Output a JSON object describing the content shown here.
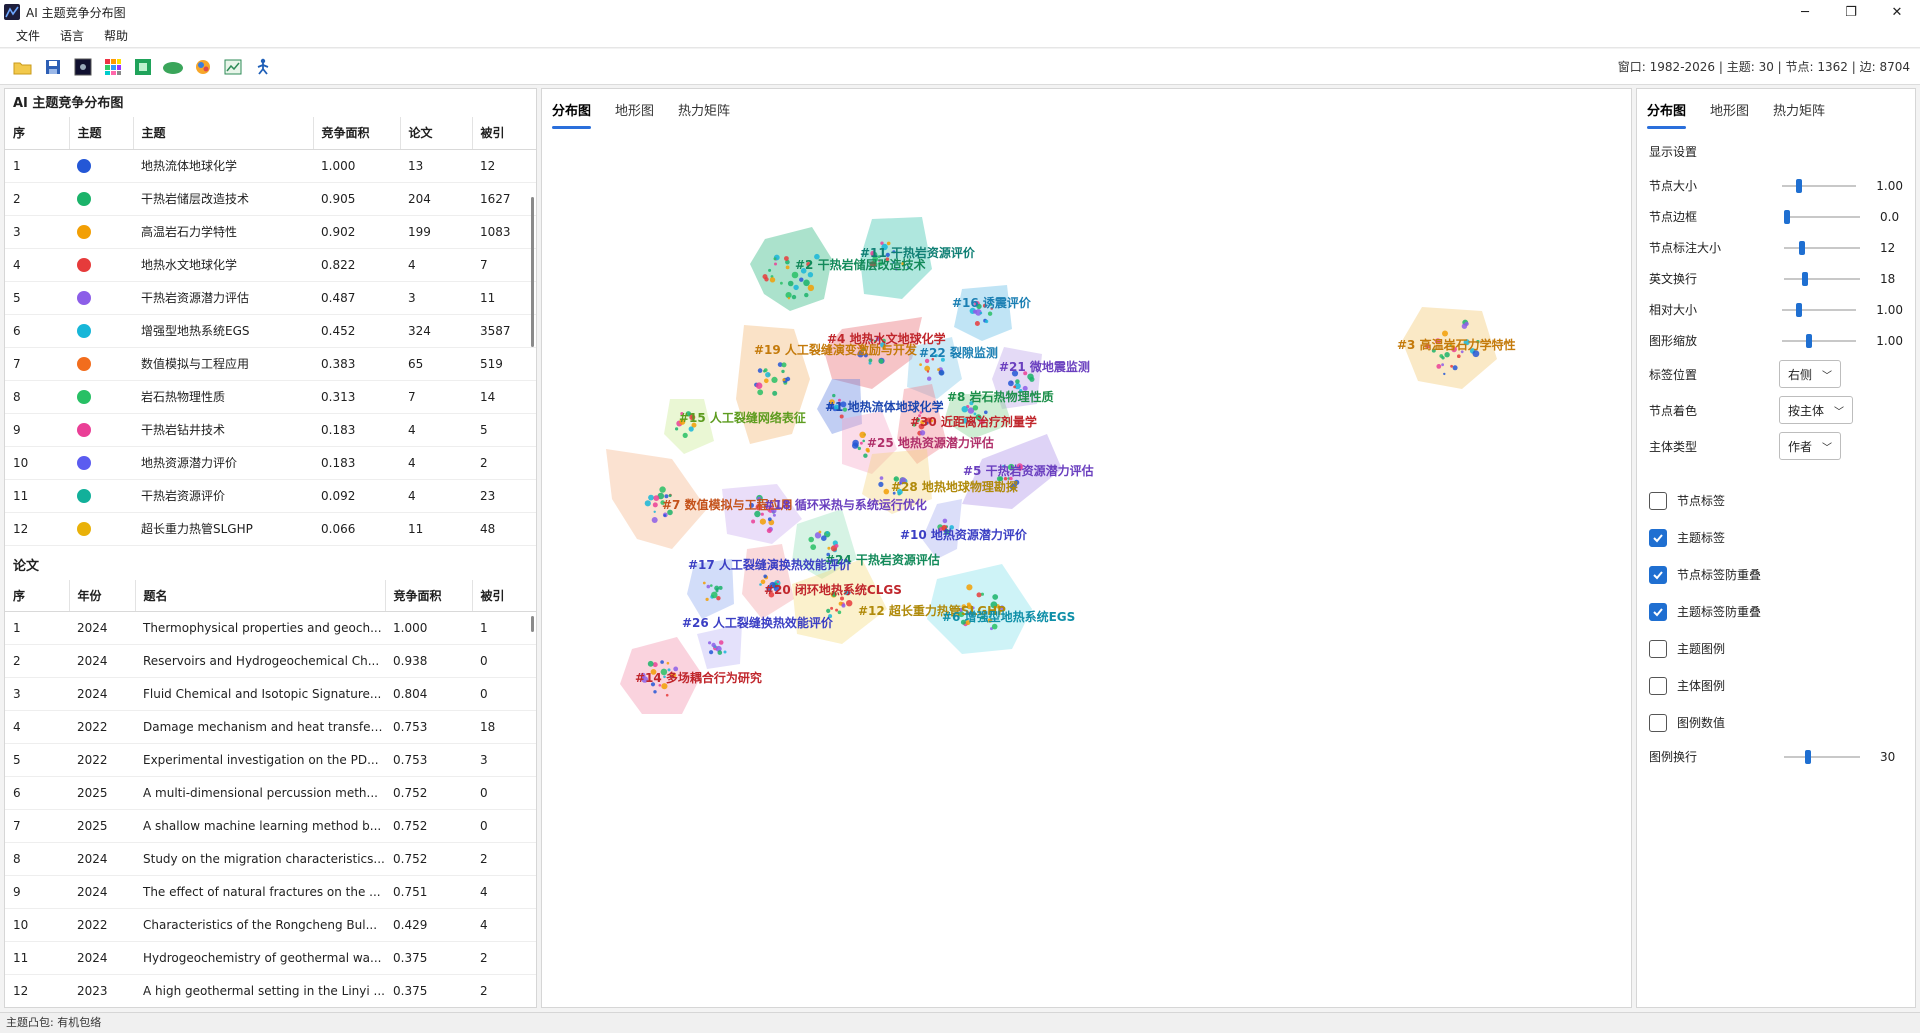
{
  "window": {
    "title": "AI 主题竞争分布图",
    "minimize": "─",
    "maximize": "❐",
    "close": "✕"
  },
  "menu": [
    "文件",
    "语言",
    "帮助"
  ],
  "toolbar": {
    "icons": [
      "open-folder-icon",
      "save-icon",
      "dark-square-icon",
      "palette-grid-icon",
      "green-frame-icon",
      "cloud-icon",
      "brain-color-icon",
      "chart-export-icon",
      "person-run-icon"
    ],
    "status": "窗口: 1982-2026 | 主题: 30 | 节点: 1362 | 边: 8704"
  },
  "topics": {
    "title": "AI 主题竞争分布图",
    "columns": [
      "序",
      "主题",
      "主题",
      "竞争面积",
      "论文",
      "被引"
    ],
    "rows": [
      {
        "idx": "1",
        "color": "#2457d6",
        "name": "地热流体地球化学",
        "score": "1.000",
        "papers": "13",
        "cites": "12"
      },
      {
        "idx": "2",
        "color": "#1bb36a",
        "name": "干热岩储层改造技术",
        "score": "0.905",
        "papers": "204",
        "cites": "1627"
      },
      {
        "idx": "3",
        "color": "#f29f05",
        "name": "高温岩石力学特性",
        "score": "0.902",
        "papers": "199",
        "cites": "1083"
      },
      {
        "idx": "4",
        "color": "#e63b3b",
        "name": "地热水文地球化学",
        "score": "0.822",
        "papers": "4",
        "cites": "7"
      },
      {
        "idx": "5",
        "color": "#8c5ee8",
        "name": "干热岩资源潜力评估",
        "score": "0.487",
        "papers": "3",
        "cites": "11"
      },
      {
        "idx": "6",
        "color": "#17b6d8",
        "name": "增强型地热系统EGS",
        "score": "0.452",
        "papers": "324",
        "cites": "3587"
      },
      {
        "idx": "7",
        "color": "#f26d1d",
        "name": "数值模拟与工程应用",
        "score": "0.383",
        "papers": "65",
        "cites": "519"
      },
      {
        "idx": "8",
        "color": "#28c065",
        "name": "岩石热物理性质",
        "score": "0.313",
        "papers": "7",
        "cites": "14"
      },
      {
        "idx": "9",
        "color": "#ea3f96",
        "name": "干热岩钻井技术",
        "score": "0.183",
        "papers": "4",
        "cites": "5"
      },
      {
        "idx": "10",
        "color": "#5b5cf0",
        "name": "地热资源潜力评价",
        "score": "0.183",
        "papers": "4",
        "cites": "2"
      },
      {
        "idx": "11",
        "color": "#12b09a",
        "name": "干热岩资源评价",
        "score": "0.092",
        "papers": "4",
        "cites": "23"
      },
      {
        "idx": "12",
        "color": "#e9b109",
        "name": "超长重力热管SLGHP",
        "score": "0.066",
        "papers": "11",
        "cites": "48"
      }
    ]
  },
  "papers": {
    "title": "论文",
    "columns": [
      "序",
      "年份",
      "题名",
      "竞争面积",
      "被引"
    ],
    "rows": [
      {
        "idx": "1",
        "year": "2024",
        "title": "Thermophysical properties and geoch...",
        "score": "1.000",
        "cites": "1"
      },
      {
        "idx": "2",
        "year": "2024",
        "title": "Reservoirs and Hydrogeochemical Ch...",
        "score": "0.938",
        "cites": "0"
      },
      {
        "idx": "3",
        "year": "2024",
        "title": "Fluid Chemical and Isotopic Signature...",
        "score": "0.804",
        "cites": "0"
      },
      {
        "idx": "4",
        "year": "2022",
        "title": "Damage mechanism and heat transfer...",
        "score": "0.753",
        "cites": "18"
      },
      {
        "idx": "5",
        "year": "2022",
        "title": "Experimental investigation on the PD...",
        "score": "0.753",
        "cites": "3"
      },
      {
        "idx": "6",
        "year": "2025",
        "title": "A multi-dimensional percussion meth...",
        "score": "0.752",
        "cites": "0"
      },
      {
        "idx": "7",
        "year": "2025",
        "title": "A shallow machine learning method b...",
        "score": "0.752",
        "cites": "0"
      },
      {
        "idx": "8",
        "year": "2024",
        "title": "Study on the migration characteristics...",
        "score": "0.752",
        "cites": "2"
      },
      {
        "idx": "9",
        "year": "2024",
        "title": "The effect of natural fractures on the ...",
        "score": "0.751",
        "cites": "4"
      },
      {
        "idx": "10",
        "year": "2022",
        "title": "Characteristics of the Rongcheng Bul...",
        "score": "0.429",
        "cites": "4"
      },
      {
        "idx": "11",
        "year": "2024",
        "title": "Hydrogeochemistry of geothermal wa...",
        "score": "0.375",
        "cites": "2"
      },
      {
        "idx": "12",
        "year": "2023",
        "title": "A high geothermal setting in the Linyi ...",
        "score": "0.375",
        "cites": "2"
      }
    ]
  },
  "center_tabs": [
    "分布图",
    "地形图",
    "热力矩阵"
  ],
  "map_labels": [
    {
      "text": "#2 干热岩储层改造技术",
      "color": "#138a5a"
    },
    {
      "text": "#11 干热岩资源评价",
      "color": "#0f7f74"
    },
    {
      "text": "#16 诱震评价",
      "color": "#1b7fb3"
    },
    {
      "text": "#4 地热水文地球化学",
      "color": "#c0262c"
    },
    {
      "text": "#19 人工裂缝演变激励与开发",
      "color": "#c47a0a"
    },
    {
      "text": "#22 裂隙监测",
      "color": "#1b7fb3"
    },
    {
      "text": "#21 微地震监测",
      "color": "#6a3fbf"
    },
    {
      "text": "#3 高温岩石力学特性",
      "color": "#c47a0a"
    },
    {
      "text": "#8 岩石热物理性质",
      "color": "#1c8f4a"
    },
    {
      "text": "#1 地热流体地球化学",
      "color": "#1d47b0"
    },
    {
      "text": "#15 人工裂缝网络表征",
      "color": "#5d9c1f"
    },
    {
      "text": "#30 近距离治疗剂量学",
      "color": "#c0262c"
    },
    {
      "text": "#25 地热资源潜力评估",
      "color": "#b0306a"
    },
    {
      "text": "#5 干热岩资源潜力评估",
      "color": "#6a3fbf"
    },
    {
      "text": "#28 地热地球物理勘探",
      "color": "#b08a0a"
    },
    {
      "text": "#7 数值模拟与工程应用",
      "color": "#c4521a"
    },
    {
      "text": "#18 循环采热与系统运行优化",
      "color": "#6a3fbf"
    },
    {
      "text": "#10 地热资源潜力评价",
      "color": "#3b3fc4"
    },
    {
      "text": "#24 干热岩资源评估",
      "color": "#138a5a"
    },
    {
      "text": "#17 人工裂缝演换热效能评价",
      "color": "#3b3fc4"
    },
    {
      "text": "#20 闭环地热系统CLGS",
      "color": "#c0262c"
    },
    {
      "text": "#12 超长重力热管SLGHP",
      "color": "#b08a0a"
    },
    {
      "text": "#6 增强型地热系统EGS",
      "color": "#0f8fa8"
    },
    {
      "text": "#26 人工裂缝换热效能评价",
      "color": "#3b3fc4"
    },
    {
      "text": "#14 多场耦合行为研究",
      "color": "#c0262c"
    }
  ],
  "right_tabs": [
    "分布图",
    "地形图",
    "热力矩阵"
  ],
  "settings": {
    "header": "显示设置",
    "sliders": [
      {
        "label": "节点大小",
        "value": "1.00",
        "level": 0.2
      },
      {
        "label": "节点边框",
        "value": "0.0",
        "level": 0.0
      },
      {
        "label": "节点标注大小",
        "value": "12",
        "level": 0.22
      },
      {
        "label": "英文换行",
        "value": "18",
        "level": 0.26
      },
      {
        "label": "相对大小",
        "value": "1.00",
        "level": 0.2
      },
      {
        "label": "图形缩放",
        "value": "1.00",
        "level": 0.35
      }
    ],
    "combos": [
      {
        "label": "标签位置",
        "value": "右侧"
      },
      {
        "label": "节点着色",
        "value": "按主体"
      },
      {
        "label": "主体类型",
        "value": "作者"
      }
    ],
    "checks": [
      {
        "label": "节点标签",
        "checked": false
      },
      {
        "label": "主题标签",
        "checked": true
      },
      {
        "label": "节点标签防重叠",
        "checked": true
      },
      {
        "label": "主题标签防重叠",
        "checked": true
      },
      {
        "label": "主题图例",
        "checked": false
      },
      {
        "label": "主体图例",
        "checked": false
      },
      {
        "label": "图例数值",
        "checked": false
      }
    ],
    "legend_wrap": {
      "label": "图例换行",
      "value": "30",
      "level": 0.3
    }
  },
  "statusbar": "主题凸包: 有机包络"
}
